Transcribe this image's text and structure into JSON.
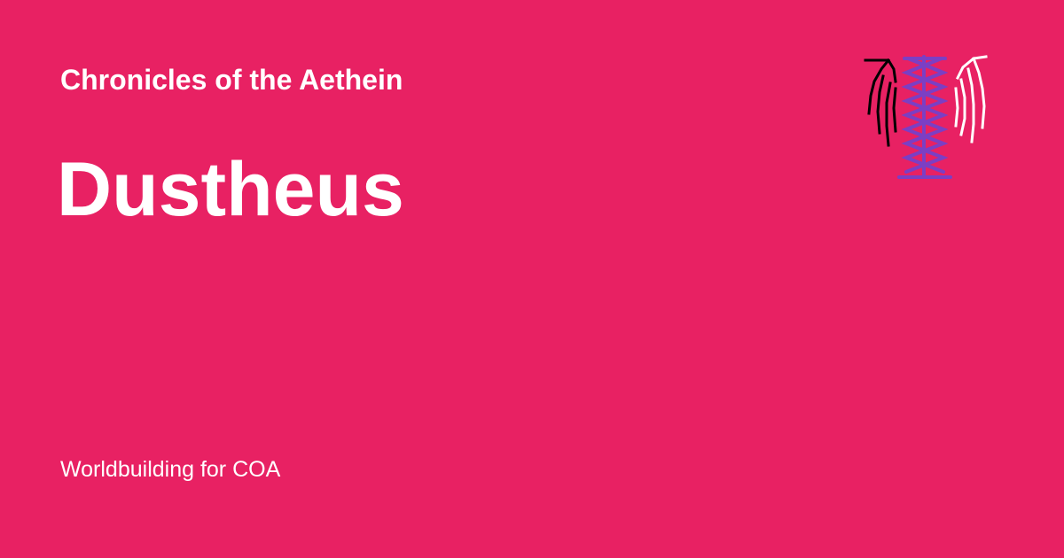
{
  "site": {
    "title": "Chronicles of the Aethein"
  },
  "page": {
    "title": "Dustheus"
  },
  "footer": {
    "text": "Worldbuilding for COA"
  },
  "logo": {
    "icon": "winged-lattice-emblem-icon",
    "wing_left_color": "#000000",
    "wing_right_color": "#ffffff",
    "lattice_color": "#7b3fc4"
  },
  "colors": {
    "background": "#e82163",
    "text": "#ffffff"
  }
}
